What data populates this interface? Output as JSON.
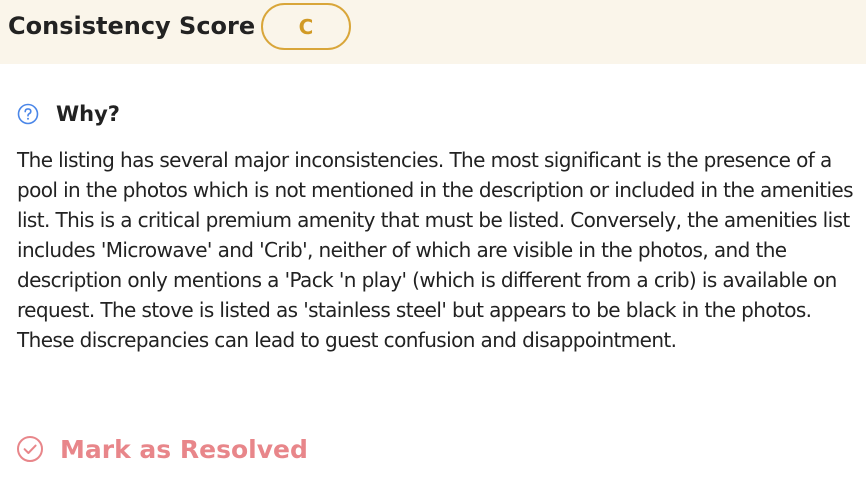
{
  "header": {
    "title": "Consistency Score",
    "grade": "C"
  },
  "why": {
    "label": "Why?",
    "icon": "question-circle-icon"
  },
  "explanation": "The listing has several major inconsistencies. The most significant is the presence of a pool in the photos which is not mentioned in the description or included in the amenities list. This is a critical premium amenity that must be listed. Conversely, the amenities list includes 'Microwave' and 'Crib', neither of which are visible in the photos, and the description only mentions a 'Pack 'n play' (which is different from a crib) is available on request. The stove is listed as 'stainless steel' but appears to be black in the photos. These discrepancies can lead to guest confusion and disappointment.",
  "resolve": {
    "label": "Mark as Resolved",
    "icon": "check-circle-icon"
  },
  "colors": {
    "header_bg": "#faf5ea",
    "grade_accent": "#d9a63a",
    "resolve_accent": "#e8868a",
    "info_icon": "#4a86e8"
  }
}
